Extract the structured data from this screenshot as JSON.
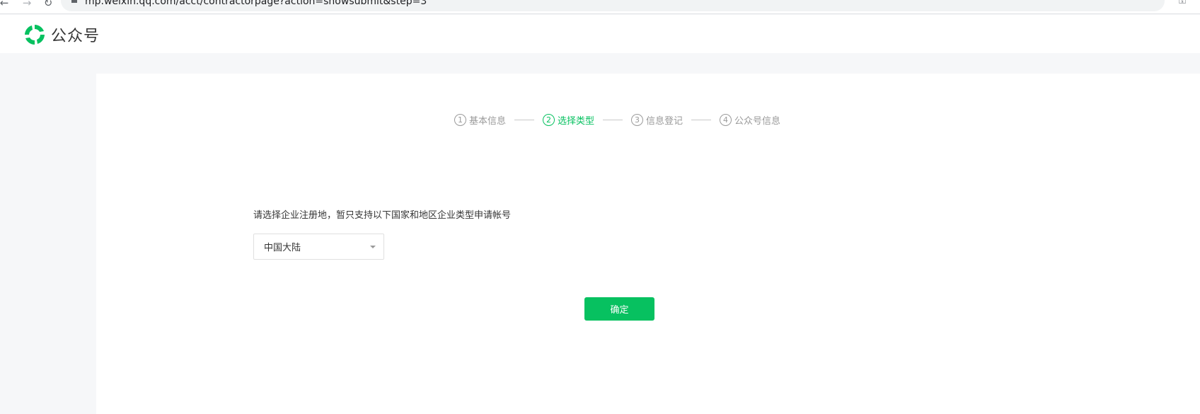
{
  "browser": {
    "url": "mp.weixin.qq.com/acct/contractorpage?action=showsubmit&step=3"
  },
  "header": {
    "logo_text": "公众号"
  },
  "steps": [
    {
      "num": "1",
      "label": "基本信息",
      "active": false
    },
    {
      "num": "2",
      "label": "选择类型",
      "active": true
    },
    {
      "num": "3",
      "label": "信息登记",
      "active": false
    },
    {
      "num": "4",
      "label": "公众号信息",
      "active": false
    }
  ],
  "form": {
    "label": "请选择企业注册地，暂只支持以下国家和地区企业类型申请帐号",
    "region_value": "中国大陆",
    "confirm_label": "确定"
  },
  "colors": {
    "brand": "#07c160",
    "inactive": "#9a9a9a"
  }
}
